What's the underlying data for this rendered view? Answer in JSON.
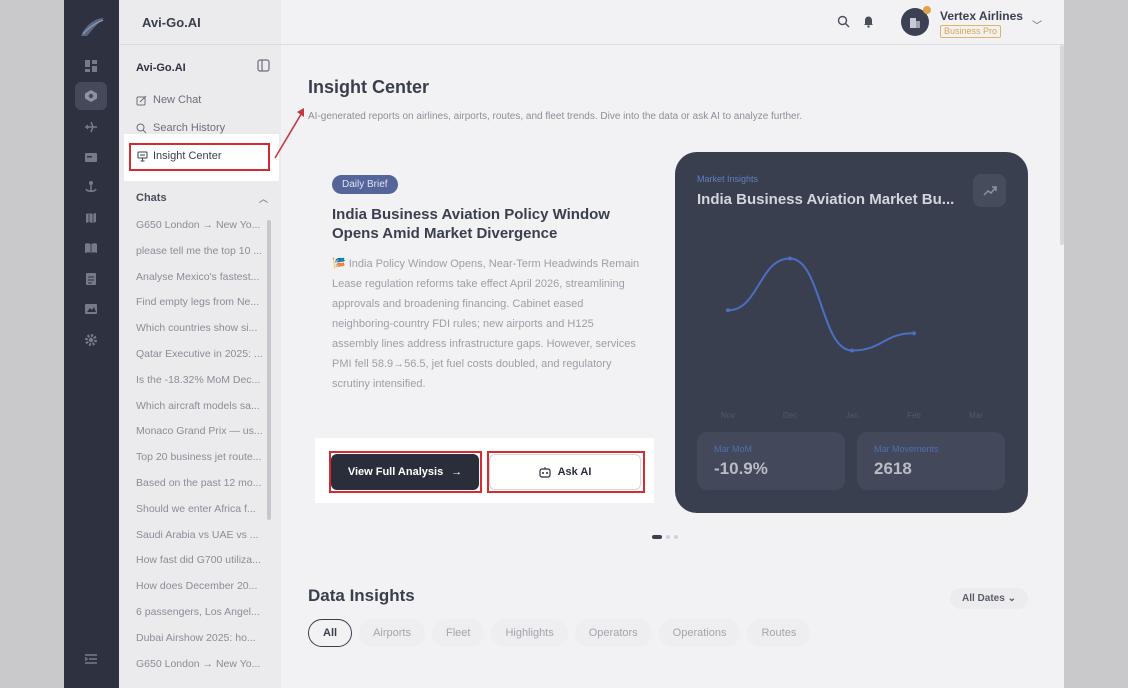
{
  "app": {
    "name": "Avi-Go.AI"
  },
  "header": {
    "company": "Vertex Airlines",
    "plan": "Business Pro"
  },
  "sidebar": {
    "title": "Avi-Go.AI",
    "nav": [
      {
        "label": "New Chat",
        "icon": "edit-icon"
      },
      {
        "label": "Search History",
        "icon": "search-icon"
      },
      {
        "label": "Insight Center",
        "icon": "presentation-icon"
      }
    ],
    "chats_label": "Chats",
    "chats": [
      "G650 London → New Yo...",
      "please tell me the top 10 ...",
      "Analyse Mexico's fastest...",
      "Find empty legs from Ne...",
      "Which countries show si...",
      "Qatar Executive in 2025: ...",
      "Is the -18.32% MoM Dec...",
      "Which aircraft models sa...",
      "Monaco Grand Prix — us...",
      "Top 20 business jet route...",
      "Based on the past 12 mo...",
      "Should we enter Africa f...",
      "Saudi Arabia vs UAE vs ...",
      "How fast did G700 utiliza...",
      "How does December 20...",
      "6 passengers, Los Angel...",
      "Dubai Airshow 2025: ho...",
      "G650 London → New Yo..."
    ]
  },
  "main": {
    "title": "Insight Center",
    "subtitle": "AI-generated reports on airlines, airports, routes, and fleet trends. Dive into the data or ask AI to analyze further.",
    "brief": {
      "badge": "Daily Brief",
      "title": "India Business Aviation Policy Window Opens Amid Market Divergence",
      "body": "🎏 India Policy Window Opens, Near-Term Headwinds Remain Lease regulation reforms take effect April 2026, streamlining approvals and broadening financing. Cabinet eased neighboring-country FDI rules; new airports and H125 assembly lines address infrastructure gaps. However, services PMI fell 58.9→56.5, jet fuel costs doubled, and regulatory scrutiny intensified.",
      "primary_button": "View Full Analysis",
      "secondary_button": "Ask AI"
    },
    "market": {
      "label": "Market Insights",
      "title": "India Business Aviation Market Bu...",
      "stat1_label": "Mar MoM",
      "stat1_value": "-10.9%",
      "stat2_label": "Mar Movements",
      "stat2_value": "2618"
    },
    "data_insights": {
      "title": "Data Insights",
      "date_filter": "All Dates",
      "tabs": [
        "All",
        "Airports",
        "Fleet",
        "Highlights",
        "Operators",
        "Operations",
        "Routes"
      ]
    }
  },
  "chart_data": {
    "type": "line",
    "categories": [
      "Nov",
      "Dec",
      "Jan",
      "Feb",
      "Mar"
    ],
    "values": [
      0.45,
      0.9,
      0.1,
      0.25,
      null
    ],
    "title": "",
    "xlabel": "",
    "ylabel": "",
    "grid": false,
    "color": "#4a6fc2"
  }
}
